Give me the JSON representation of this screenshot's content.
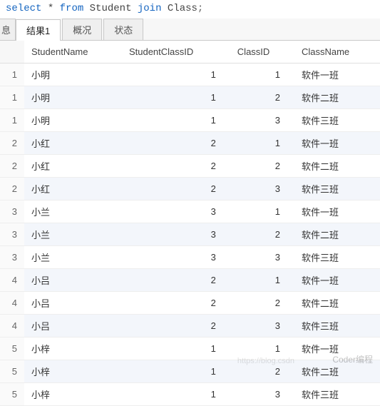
{
  "sql": {
    "kw_select": "select",
    "star": "*",
    "kw_from": "from",
    "tbl1": "Student",
    "kw_join": "join",
    "tbl2": "Class",
    "semi": ";"
  },
  "tabs": {
    "fragment": "息",
    "items": [
      {
        "label": "结果1",
        "active": true
      },
      {
        "label": "概况",
        "active": false
      },
      {
        "label": "状态",
        "active": false
      }
    ]
  },
  "grid": {
    "columns": [
      "StudentName",
      "StudentClassID",
      "ClassID",
      "ClassName"
    ],
    "rows": [
      {
        "n": 1,
        "StudentName": "小明",
        "StudentClassID": 1,
        "ClassID": 1,
        "ClassName": "软件一班"
      },
      {
        "n": 1,
        "StudentName": "小明",
        "StudentClassID": 1,
        "ClassID": 2,
        "ClassName": "软件二班"
      },
      {
        "n": 1,
        "StudentName": "小明",
        "StudentClassID": 1,
        "ClassID": 3,
        "ClassName": "软件三班"
      },
      {
        "n": 2,
        "StudentName": "小红",
        "StudentClassID": 2,
        "ClassID": 1,
        "ClassName": "软件一班"
      },
      {
        "n": 2,
        "StudentName": "小红",
        "StudentClassID": 2,
        "ClassID": 2,
        "ClassName": "软件二班"
      },
      {
        "n": 2,
        "StudentName": "小红",
        "StudentClassID": 2,
        "ClassID": 3,
        "ClassName": "软件三班"
      },
      {
        "n": 3,
        "StudentName": "小兰",
        "StudentClassID": 3,
        "ClassID": 1,
        "ClassName": "软件一班"
      },
      {
        "n": 3,
        "StudentName": "小兰",
        "StudentClassID": 3,
        "ClassID": 2,
        "ClassName": "软件二班"
      },
      {
        "n": 3,
        "StudentName": "小兰",
        "StudentClassID": 3,
        "ClassID": 3,
        "ClassName": "软件三班"
      },
      {
        "n": 4,
        "StudentName": "小吕",
        "StudentClassID": 2,
        "ClassID": 1,
        "ClassName": "软件一班"
      },
      {
        "n": 4,
        "StudentName": "小吕",
        "StudentClassID": 2,
        "ClassID": 2,
        "ClassName": "软件二班"
      },
      {
        "n": 4,
        "StudentName": "小吕",
        "StudentClassID": 2,
        "ClassID": 3,
        "ClassName": "软件三班"
      },
      {
        "n": 5,
        "StudentName": "小梓",
        "StudentClassID": 1,
        "ClassID": 1,
        "ClassName": "软件一班"
      },
      {
        "n": 5,
        "StudentName": "小梓",
        "StudentClassID": 1,
        "ClassID": 2,
        "ClassName": "软件二班"
      },
      {
        "n": 5,
        "StudentName": "小梓",
        "StudentClassID": 1,
        "ClassID": 3,
        "ClassName": "软件三班"
      }
    ]
  },
  "watermark": {
    "main": "Coder编程",
    "faint": "https://blog.csdn"
  }
}
